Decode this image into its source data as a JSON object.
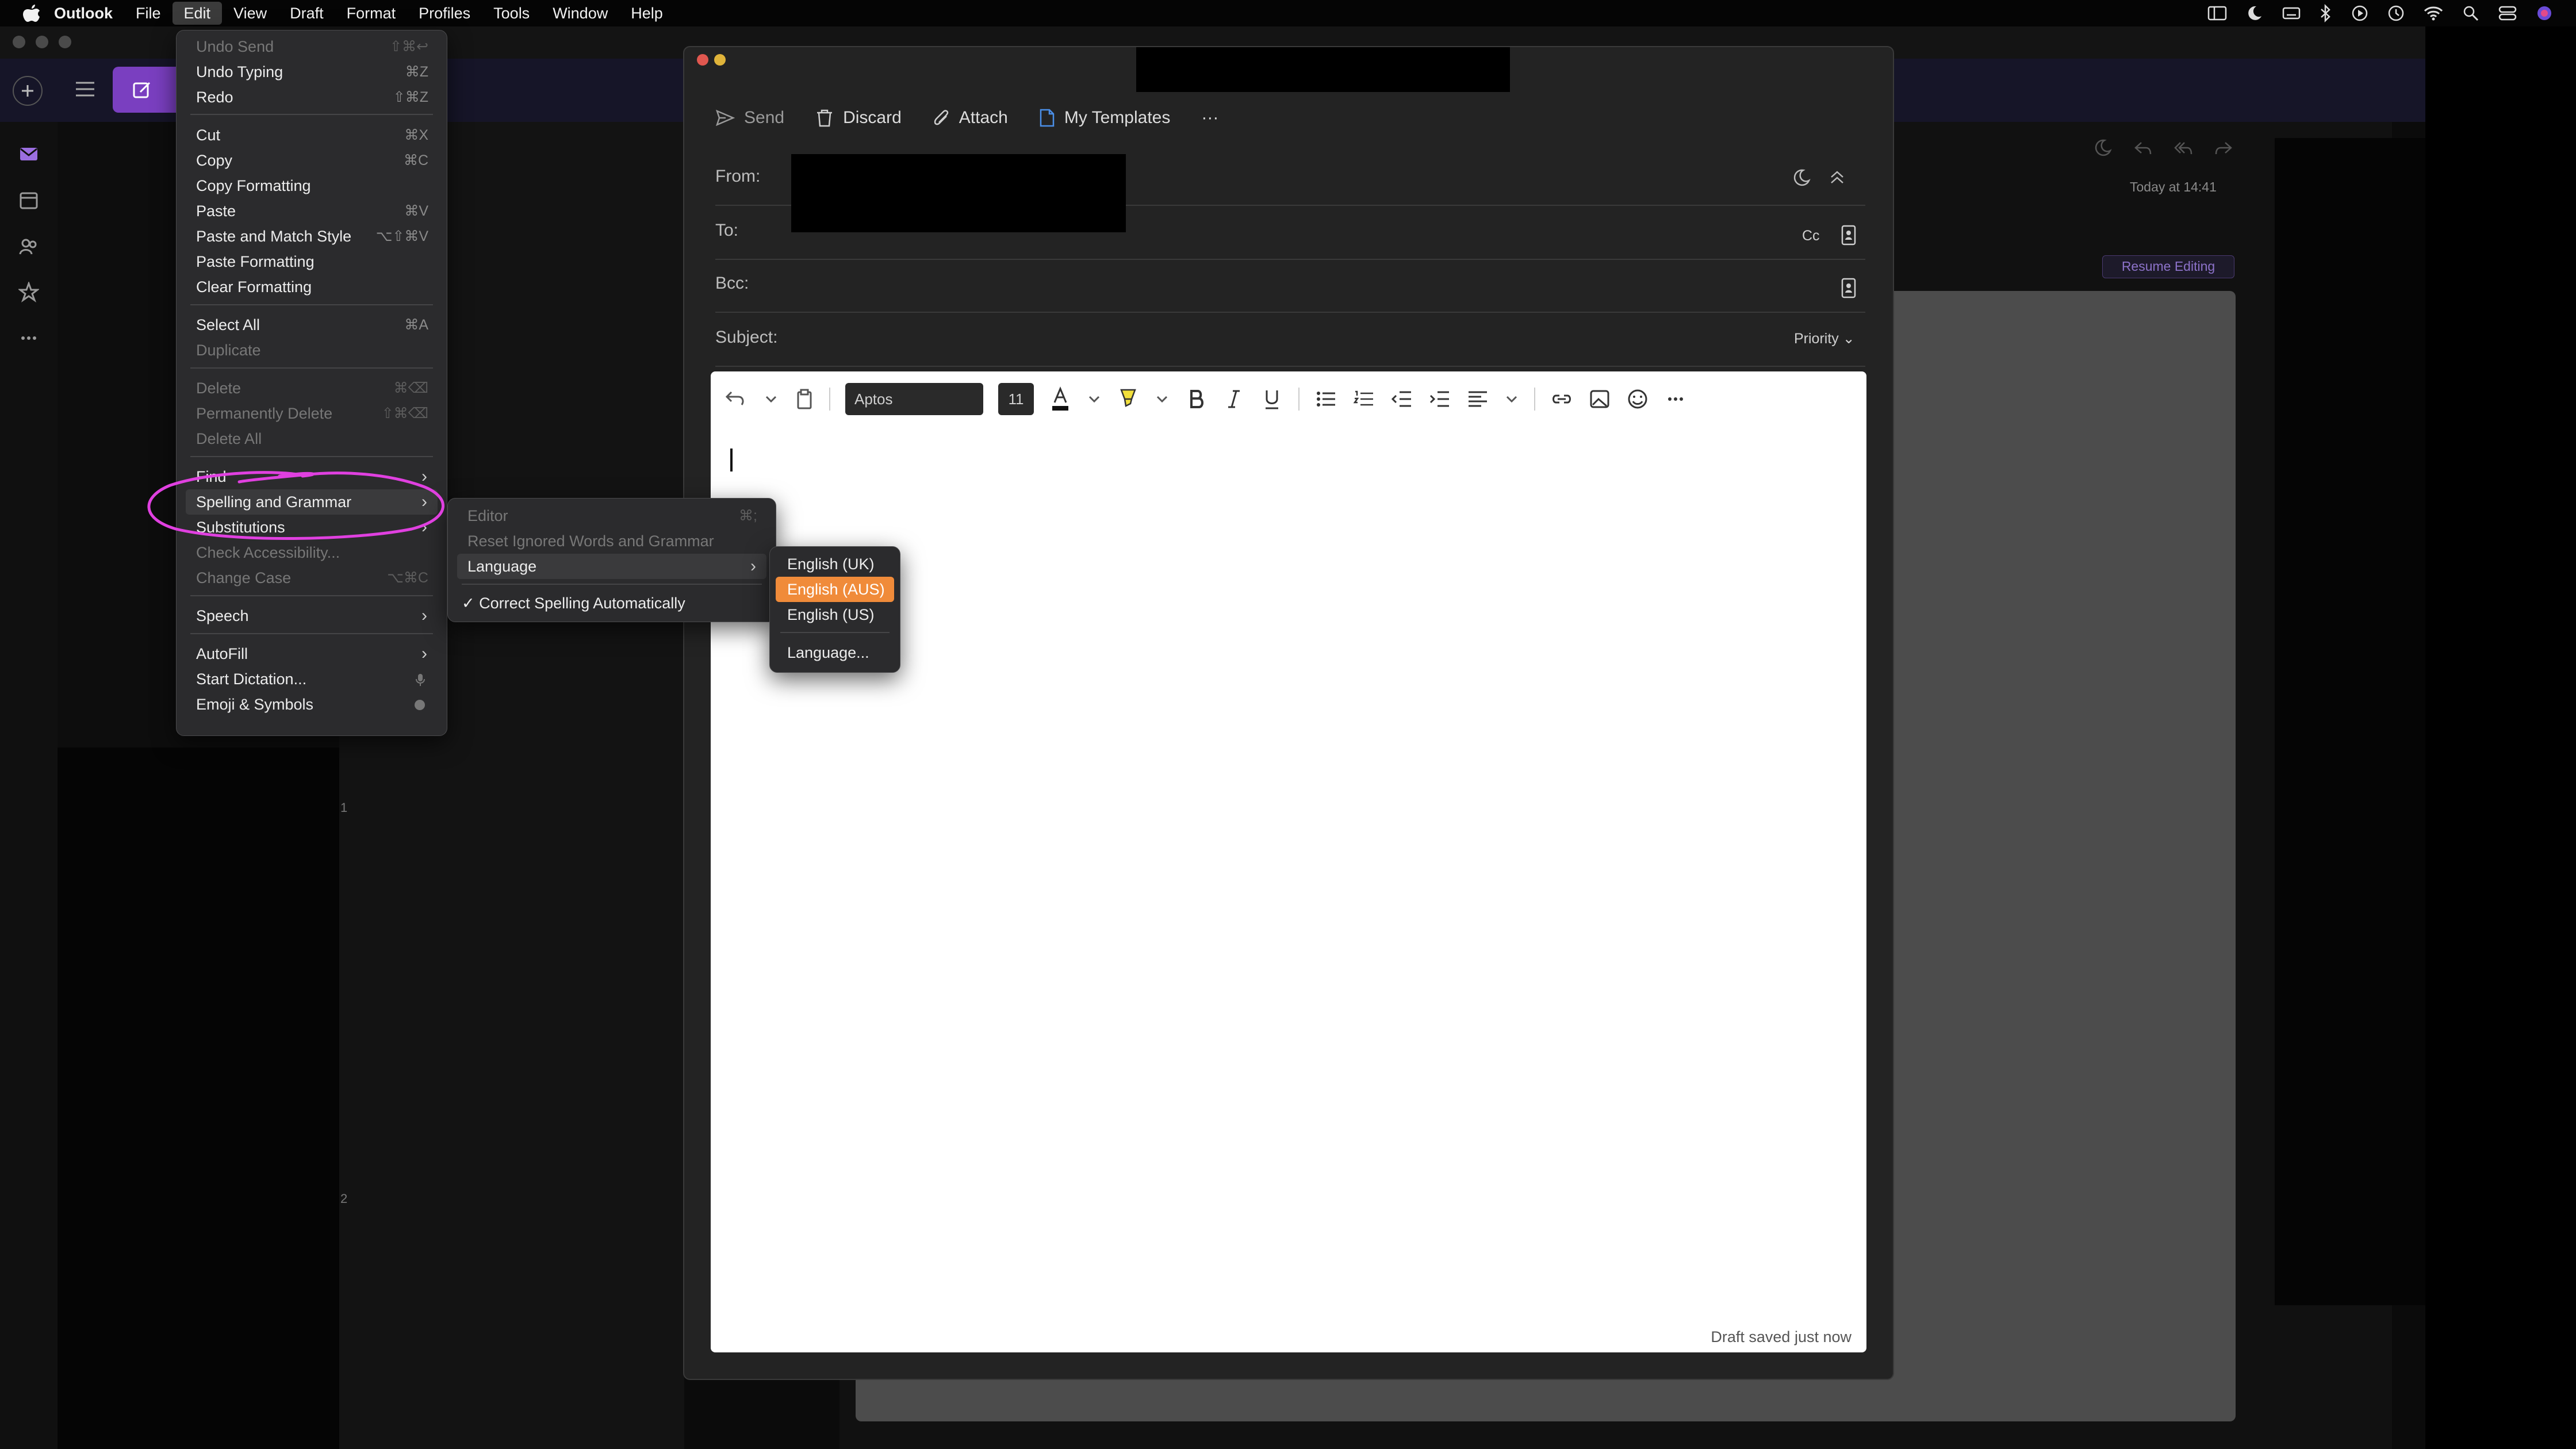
{
  "menubar": {
    "app": "Outlook",
    "items": [
      "File",
      "Edit",
      "View",
      "Draft",
      "Format",
      "Profiles",
      "Tools",
      "Window",
      "Help"
    ],
    "active": "Edit"
  },
  "edit_menu": {
    "items": [
      {
        "label": "Undo Send",
        "shortcut": "⇧⌘↩",
        "disabled": true
      },
      {
        "label": "Undo Typing",
        "shortcut": "⌘Z"
      },
      {
        "label": "Redo",
        "shortcut": "⇧⌘Z"
      },
      {
        "label": "Cut",
        "shortcut": "⌘X"
      },
      {
        "label": "Copy",
        "shortcut": "⌘C"
      },
      {
        "label": "Copy Formatting",
        "shortcut": ""
      },
      {
        "label": "Paste",
        "shortcut": "⌘V"
      },
      {
        "label": "Paste and Match Style",
        "shortcut": "⌥⇧⌘V"
      },
      {
        "label": "Paste Formatting",
        "shortcut": ""
      },
      {
        "label": "Clear Formatting",
        "shortcut": ""
      },
      {
        "label": "Select All",
        "shortcut": "⌘A"
      },
      {
        "label": "Duplicate",
        "shortcut": "",
        "disabled": true
      },
      {
        "label": "Delete",
        "shortcut": "⌘⌫",
        "disabled": true
      },
      {
        "label": "Permanently Delete",
        "shortcut": "⇧⌘⌫",
        "disabled": true
      },
      {
        "label": "Delete All",
        "shortcut": "",
        "disabled": true
      },
      {
        "label": "Find",
        "shortcut": ""
      },
      {
        "label": "Spelling and Grammar",
        "shortcut": ""
      },
      {
        "label": "Substitutions",
        "shortcut": ""
      },
      {
        "label": "Check Accessibility...",
        "shortcut": "",
        "disabled": true
      },
      {
        "label": "Change Case",
        "shortcut": "⌥⌘C",
        "disabled": true
      },
      {
        "label": "Speech",
        "shortcut": ""
      },
      {
        "label": "AutoFill",
        "shortcut": ""
      },
      {
        "label": "Start Dictation...",
        "shortcut": ""
      },
      {
        "label": "Emoji & Symbols",
        "shortcut": ""
      }
    ]
  },
  "spelling_menu": {
    "items": [
      {
        "label": "Editor",
        "shortcut": "⌘;",
        "disabled": true
      },
      {
        "label": "Reset Ignored Words and Grammar",
        "disabled": true
      },
      {
        "label": "Language"
      },
      {
        "label": "✓ Correct Spelling Automatically"
      }
    ]
  },
  "language_menu": {
    "items": [
      "English (UK)",
      "English (AUS)",
      "English (US)",
      "Language..."
    ],
    "selected": "English (AUS)"
  },
  "compose": {
    "toolbar": {
      "send": "Send",
      "discard": "Discard",
      "attach": "Attach",
      "templates": "My Templates",
      "more": "···"
    },
    "from_label": "From:",
    "to_label": "To:",
    "cc_label": "Cc",
    "bcc_label": "Bcc:",
    "subject_label": "Subject:",
    "priority_label": "Priority",
    "font_name": "Aptos",
    "font_size": "11",
    "draft_status": "Draft saved just now"
  },
  "reading": {
    "timestamp": "Today at 14:41",
    "resume_editing": "Resume Editing"
  },
  "background": {
    "folder_numbers": [
      "1",
      "2"
    ]
  },
  "colors": {
    "accent": "#7a3fc0",
    "highlight_menu": "#f08b3a",
    "annotation_circle": "#e040e0"
  }
}
